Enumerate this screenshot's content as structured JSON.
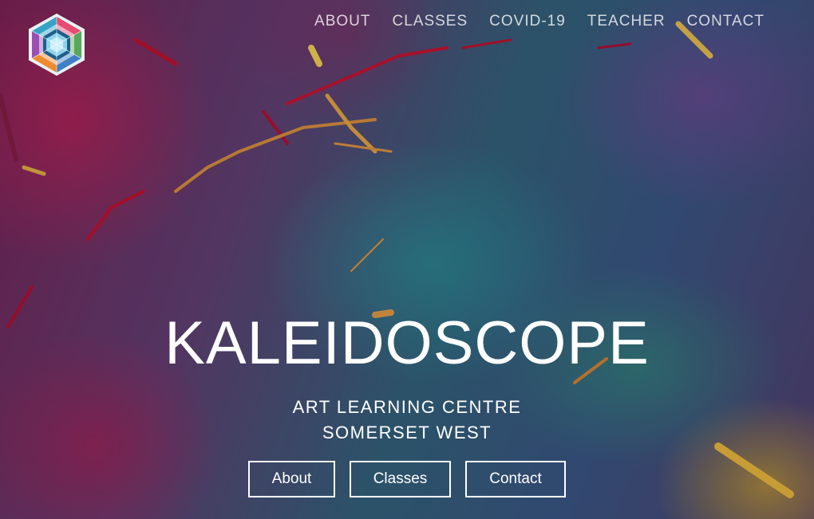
{
  "brand": {
    "logo_icon": "kaleidoscope-hexagon-logo-icon"
  },
  "nav": {
    "items": [
      {
        "label": "ABOUT"
      },
      {
        "label": "CLASSES"
      },
      {
        "label": "COVID-19"
      },
      {
        "label": "TEACHER"
      },
      {
        "label": "CONTACT"
      }
    ]
  },
  "hero": {
    "title": "KALEIDOSCOPE",
    "subtitle_line1": "ART LEARNING CENTRE",
    "subtitle_line2": "SOMERSET WEST",
    "buttons": [
      {
        "label": "About"
      },
      {
        "label": "Classes"
      },
      {
        "label": "Contact"
      }
    ]
  },
  "colors": {
    "text": "#ffffff",
    "nav_text": "#e6dbe4",
    "button_border": "#ffffff"
  }
}
